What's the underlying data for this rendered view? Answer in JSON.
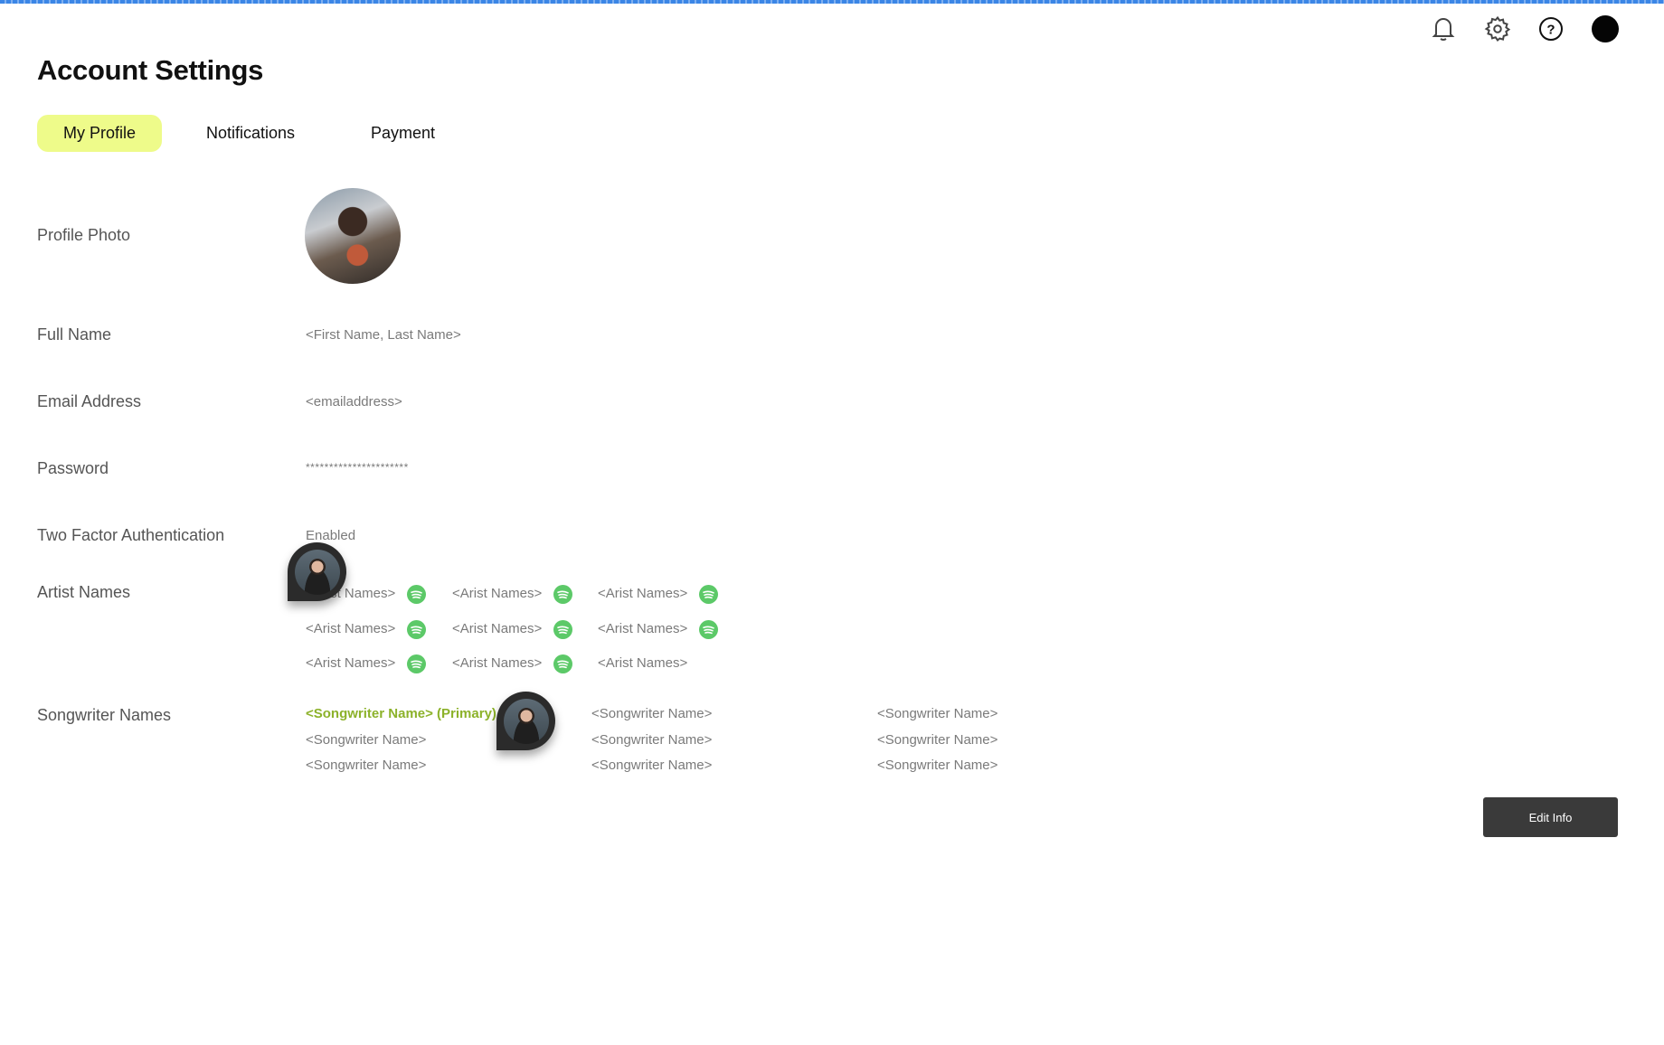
{
  "header": {
    "title": "Account Settings",
    "icons": [
      "bell-icon",
      "gear-icon",
      "help-icon",
      "avatar"
    ]
  },
  "tabs": [
    {
      "label": "My Profile",
      "active": true
    },
    {
      "label": "Notifications"
    },
    {
      "label": "Payment"
    }
  ],
  "profile": {
    "photo_label": "Profile Photo",
    "full_name_label": "Full Name",
    "full_name": "<First Name, Last Name>",
    "email_label": "Email Address",
    "email": "<emailaddress>",
    "password_label": "Password",
    "password": "**********************",
    "tfa_label": "Two Factor Authentication",
    "tfa": "Enabled",
    "artist_label": "Artist Names",
    "artists": [
      "<Arist Names>",
      "<Arist Names>",
      "<Arist Names>",
      "<Arist Names>",
      "<Arist Names>",
      "<Arist Names>",
      "<Arist Names>",
      "<Arist Names>",
      "<Arist Names>"
    ],
    "songwriter_label": "Songwriter Names",
    "songwriters": [
      "<Songwriter Name> (Primary)",
      "<Songwriter Name>",
      "<Songwriter Name>",
      "<Songwriter Name>",
      "<Songwriter Name>",
      "<Songwriter Name>",
      "<Songwriter Name>",
      "<Songwriter Name>",
      "<Songwriter Name>"
    ]
  },
  "edit_button": "Edit Info",
  "colors": {
    "accent": "#eefb8a",
    "spotify": "#5cc968",
    "primary_songwriter": "#8cb22a",
    "button": "#3a3a3a"
  }
}
